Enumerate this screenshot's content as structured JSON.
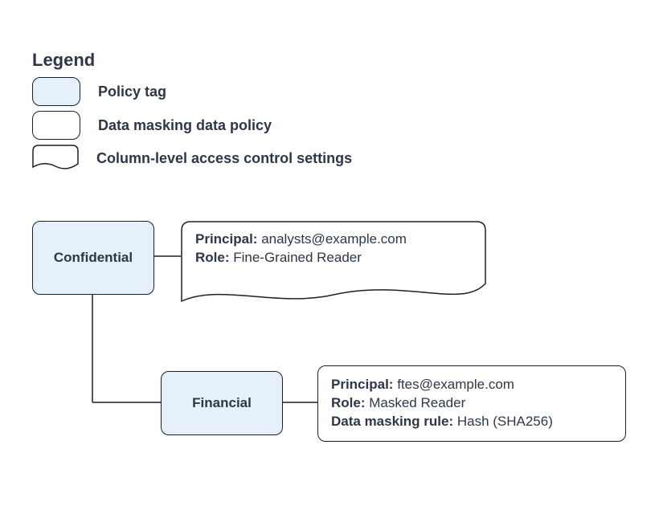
{
  "legend": {
    "title": "Legend",
    "items": [
      {
        "label": "Policy tag"
      },
      {
        "label": "Data masking data policy"
      },
      {
        "label": "Column-level access control settings"
      }
    ]
  },
  "diagram": {
    "confidential": {
      "label": "Confidential",
      "note": {
        "principal_key": "Principal:",
        "principal_val": " analysts@example.com",
        "role_key": "Role:",
        "role_val": " Fine-Grained Reader"
      }
    },
    "financial": {
      "label": "Financial",
      "policy": {
        "principal_key": "Principal:",
        "principal_val": " ftes@example.com",
        "role_key": "Role:",
        "role_val": " Masked Reader",
        "rule_key": "Data masking rule:",
        "rule_val": " Hash (SHA256)"
      }
    }
  }
}
